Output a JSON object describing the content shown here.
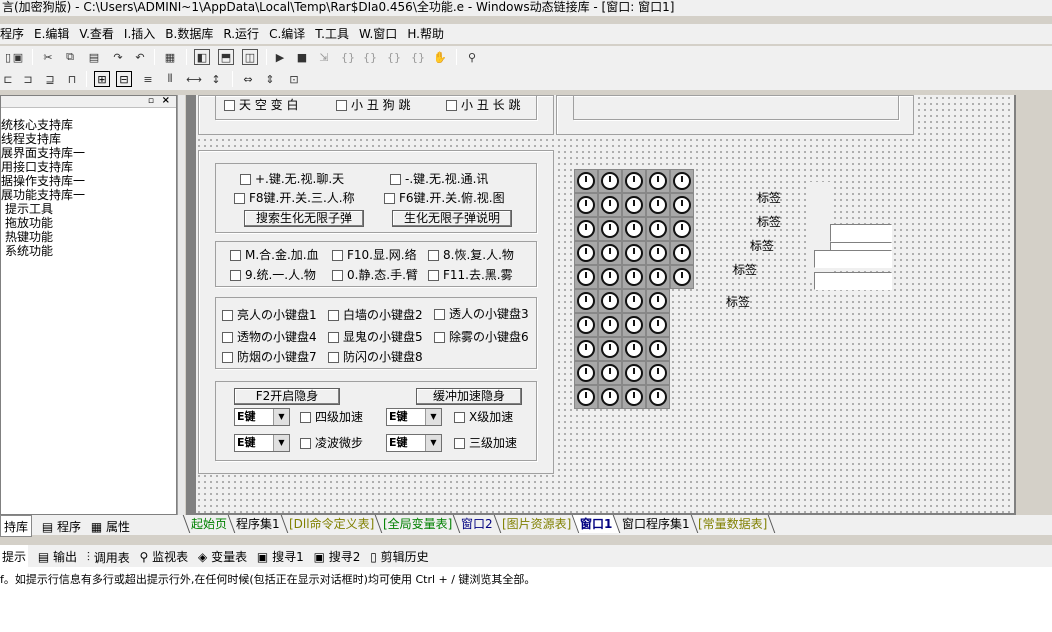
{
  "window": {
    "title": "言(加密狗版) - C:\\Users\\ADMINI~1\\AppData\\Local\\Temp\\Rar$DIa0.456\\全功能.e - Windows动态链接库 - [窗口: 窗口1]"
  },
  "menu": [
    "程序",
    "E.编辑",
    "V.查看",
    "I.插入",
    "B.数据库",
    "R.运行",
    "C.编译",
    "T.工具",
    "W.窗口",
    "H.帮助"
  ],
  "support_libs": [
    "统核心支持库",
    "线程支持库",
    "展界面支持库一",
    "用接口支持库",
    "据操作支持库一",
    "展功能支持库一",
    "提示工具",
    "拖放功能",
    "热键功能",
    "系统功能"
  ],
  "group_top": {
    "checks": [
      "天 空 变 白",
      "小 丑 狗 跳",
      "小 丑 长 跳"
    ]
  },
  "group1": {
    "checks": [
      "+.键.无.视.聊.天",
      "-.键.无.视.通.讯",
      "F8键.开.关.三.人.称",
      "F6键.开.关.俯.视.图"
    ],
    "buttons": [
      "搜索生化无限子弹",
      "生化无限子弹说明"
    ]
  },
  "group2": {
    "checks": [
      "M.合.金.加.血",
      "F10.显.网.络",
      "8.恢.复.人.物",
      "9.统.一.人.物",
      "0.静.态.手.臂",
      "F11.去.黑.雾"
    ]
  },
  "group3": {
    "checks": [
      "亮人の小键盘1",
      "白墙の小键盘2",
      "透人の小键盘3",
      "透物の小键盘4",
      "显鬼の小键盘5",
      "除雾の小键盘6",
      "防烟の小键盘7",
      "防闪の小键盘8"
    ]
  },
  "group4": {
    "buttons": [
      "F2开启隐身",
      "缓冲加速隐身"
    ],
    "combos": [
      "E键",
      "E键",
      "E键",
      "E键"
    ],
    "checks": [
      "四级加速",
      "X级加速",
      "凌波微步",
      "三级加速"
    ]
  },
  "labels": [
    "标签",
    "标签",
    "标签",
    "标签",
    "标签"
  ],
  "left_tabs": [
    "持库",
    "程序",
    "属性"
  ],
  "editor_tabs": [
    "起始页",
    "程序集1",
    "[Dll命令定义表]",
    "[全局变量表]",
    "窗口2",
    "[图片资源表]",
    "窗口1",
    "窗口程序集1",
    "[常量数据表]"
  ],
  "active_tab": "窗口1",
  "output_tabs": [
    "提示",
    "输出",
    "调用表",
    "监视表",
    "变量表",
    "搜寻1",
    "搜寻2",
    "剪辑历史"
  ],
  "output_text": "f。如提示行信息有多行或超出提示行外,在任何时候(包括正在显示对话框时)均可使用 Ctrl + / 键浏览其全部。",
  "colors": {
    "tab_green": "#008000",
    "tab_olive": "#808000",
    "tab_blue": "#000080"
  }
}
